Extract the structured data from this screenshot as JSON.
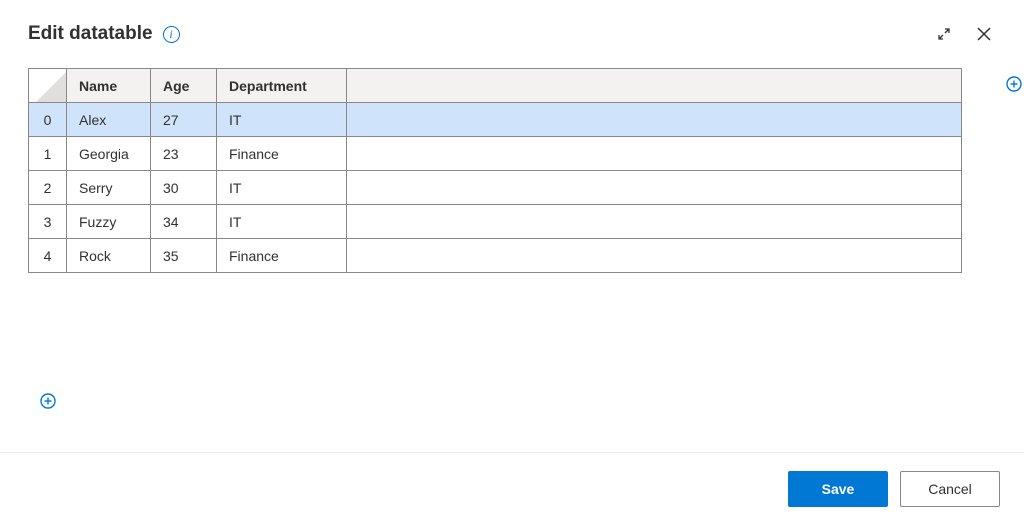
{
  "dialog": {
    "title": "Edit datatable"
  },
  "table": {
    "columns": [
      "Name",
      "Age",
      "Department"
    ],
    "rows": [
      {
        "idx": "0",
        "name": "Alex",
        "age": "27",
        "dept": "IT"
      },
      {
        "idx": "1",
        "name": "Georgia",
        "age": "23",
        "dept": "Finance"
      },
      {
        "idx": "2",
        "name": "Serry",
        "age": "30",
        "dept": "IT"
      },
      {
        "idx": "3",
        "name": "Fuzzy",
        "age": "34",
        "dept": "IT"
      },
      {
        "idx": "4",
        "name": "Rock",
        "age": "35",
        "dept": "Finance"
      }
    ],
    "selectedIndex": 0
  },
  "footer": {
    "save": "Save",
    "cancel": "Cancel"
  }
}
